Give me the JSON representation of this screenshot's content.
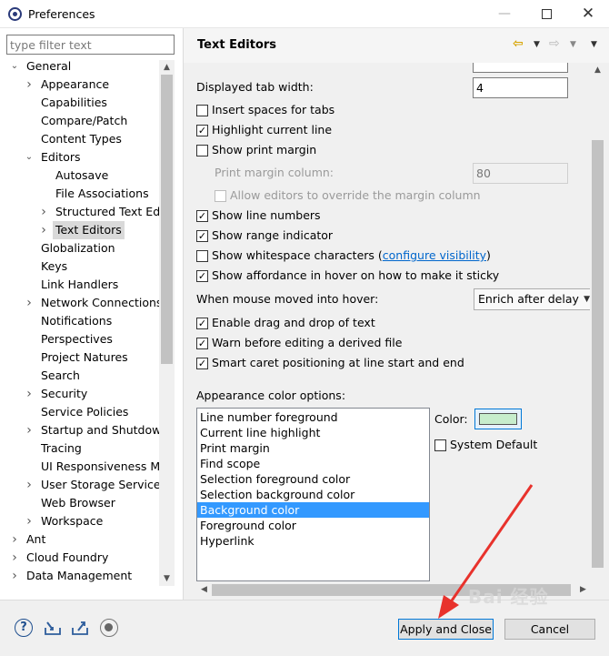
{
  "window": {
    "title": "Preferences"
  },
  "left": {
    "filter_placeholder": "type filter text",
    "tree": [
      {
        "label": "General",
        "level": 0,
        "arrow": "expanded"
      },
      {
        "label": "Appearance",
        "level": 1,
        "arrow": "collapsed"
      },
      {
        "label": "Capabilities",
        "level": 1,
        "arrow": ""
      },
      {
        "label": "Compare/Patch",
        "level": 1,
        "arrow": ""
      },
      {
        "label": "Content Types",
        "level": 1,
        "arrow": ""
      },
      {
        "label": "Editors",
        "level": 1,
        "arrow": "expanded"
      },
      {
        "label": "Autosave",
        "level": 2,
        "arrow": ""
      },
      {
        "label": "File Associations",
        "level": 2,
        "arrow": ""
      },
      {
        "label": "Structured Text Edit",
        "level": 2,
        "arrow": "collapsed"
      },
      {
        "label": "Text Editors",
        "level": 2,
        "arrow": "collapsed",
        "selected": true
      },
      {
        "label": "Globalization",
        "level": 1,
        "arrow": ""
      },
      {
        "label": "Keys",
        "level": 1,
        "arrow": ""
      },
      {
        "label": "Link Handlers",
        "level": 1,
        "arrow": ""
      },
      {
        "label": "Network Connections",
        "level": 1,
        "arrow": "collapsed"
      },
      {
        "label": "Notifications",
        "level": 1,
        "arrow": ""
      },
      {
        "label": "Perspectives",
        "level": 1,
        "arrow": ""
      },
      {
        "label": "Project Natures",
        "level": 1,
        "arrow": ""
      },
      {
        "label": "Search",
        "level": 1,
        "arrow": ""
      },
      {
        "label": "Security",
        "level": 1,
        "arrow": "collapsed"
      },
      {
        "label": "Service Policies",
        "level": 1,
        "arrow": ""
      },
      {
        "label": "Startup and Shutdown",
        "level": 1,
        "arrow": "collapsed"
      },
      {
        "label": "Tracing",
        "level": 1,
        "arrow": ""
      },
      {
        "label": "UI Responsiveness Mo",
        "level": 1,
        "arrow": ""
      },
      {
        "label": "User Storage Service",
        "level": 1,
        "arrow": "collapsed"
      },
      {
        "label": "Web Browser",
        "level": 1,
        "arrow": ""
      },
      {
        "label": "Workspace",
        "level": 1,
        "arrow": "collapsed"
      },
      {
        "label": "Ant",
        "level": 0,
        "arrow": "collapsed"
      },
      {
        "label": "Cloud Foundry",
        "level": 0,
        "arrow": "collapsed"
      },
      {
        "label": "Data Management",
        "level": 0,
        "arrow": "collapsed"
      }
    ]
  },
  "page": {
    "title": "Text Editors",
    "tab_width_label": "Displayed tab width:",
    "tab_width_value": "4",
    "insert_spaces": {
      "label": "Insert spaces for tabs",
      "checked": false
    },
    "highlight_line": {
      "label": "Highlight current line",
      "checked": true
    },
    "show_print_margin": {
      "label": "Show print margin",
      "checked": false
    },
    "print_margin_label": "Print margin column:",
    "print_margin_value": "80",
    "allow_override": {
      "label": "Allow editors to override the margin column",
      "checked": false
    },
    "show_line_numbers": {
      "label": "Show line numbers",
      "checked": true
    },
    "show_range": {
      "label": "Show range indicator",
      "checked": true
    },
    "show_whitespace": {
      "label": "Show whitespace characters (",
      "link": "configure visibility",
      "suffix": ")",
      "checked": false
    },
    "show_affordance": {
      "label": "Show affordance in hover on how to make it sticky",
      "checked": true
    },
    "hover_label": "When mouse moved into hover:",
    "hover_value": "Enrich after delay",
    "drag_drop": {
      "label": "Enable drag and drop of text",
      "checked": true
    },
    "warn_derived": {
      "label": "Warn before editing a derived file",
      "checked": true
    },
    "smart_caret": {
      "label": "Smart caret positioning at line start and end",
      "checked": true
    },
    "appearance_label": "Appearance color options:",
    "color_options": [
      "Line number foreground",
      "Current line highlight",
      "Print margin",
      "Find scope",
      "Selection foreground color",
      "Selection background color",
      "Background color",
      "Foreground color",
      "Hyperlink"
    ],
    "selected_option_index": 6,
    "color_label": "Color:",
    "color_value": "#c7edcc",
    "system_default": {
      "label": "System Default",
      "checked": false
    }
  },
  "footer": {
    "apply_close": "Apply and Close",
    "cancel": "Cancel"
  },
  "watermark": "Bai 经验",
  "colors": {
    "selection": "#3399ff",
    "accent_arrow": "#e8322c"
  }
}
